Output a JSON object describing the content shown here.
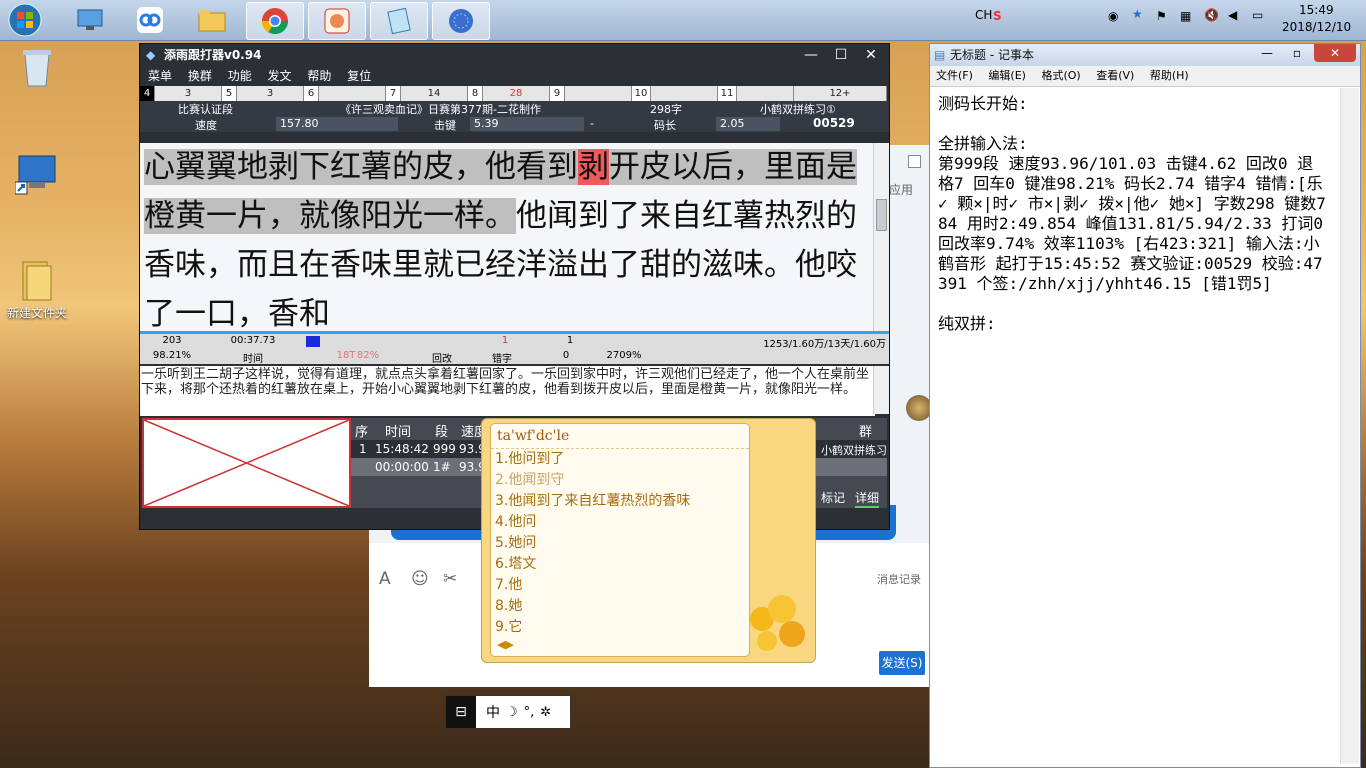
{
  "taskbar": {
    "apps": [
      {
        "icon": "start-orb-icon"
      },
      {
        "icon": "remote-desktop-icon"
      },
      {
        "icon": "baidu-netdisk-icon"
      },
      {
        "icon": "file-explorer-icon"
      },
      {
        "icon": "chrome-icon"
      },
      {
        "icon": "app-typing-icon"
      },
      {
        "icon": "notepad-icon"
      },
      {
        "icon": "blue-sphere-icon"
      }
    ],
    "tray": {
      "ime": "CH",
      "time": "15:49",
      "date": "2018/12/10"
    }
  },
  "desktop": {
    "icons": [
      {
        "label": "",
        "icon": "recycle-bin-icon"
      },
      {
        "label": "",
        "icon": "computer-shortcut-icon"
      },
      {
        "label": "新建文件夹",
        "icon": "folder-icon"
      }
    ]
  },
  "typer": {
    "title": "添雨跟打器v0.94",
    "menu": [
      "菜单",
      "换群",
      "功能",
      "发文",
      "帮助",
      "复位"
    ],
    "cells": [
      "4",
      "3",
      "5",
      "3",
      "6",
      "",
      "7",
      "14",
      "8",
      "28",
      "9",
      "",
      "10",
      "",
      "11",
      "",
      "12+"
    ],
    "info": {
      "mode": "比赛认证段",
      "article": "《许三观卖血记》日赛第377期-二花制作",
      "chars": "298字",
      "course": "小鹤双拼练习①"
    },
    "readout": {
      "speed_label": "速度",
      "speed": "157.80",
      "keystroke_label": "击键",
      "keystroke": "5.39",
      "dash": "-",
      "codelen_label": "码长",
      "codelen": "2.05",
      "code": "00529"
    },
    "text_typed": "心翼翼地剥下红薯的皮，他看到",
    "text_wrong": "剥",
    "text_typed2": "开皮以后，里面是橙黄一片，就像阳光一样。",
    "text_rest": "他闻到了来自红薯热烈的香味，而且在香味里就已经洋溢出了甜的滋味。他咬了一口，香和",
    "stats_row1": {
      "a": "203",
      "b": "00:37.73",
      "c": "1",
      "d": "1",
      "e": "1253/1.60万/13天/1.60万"
    },
    "stats_row2": {
      "a": "98.21%",
      "b": "时间",
      "c": "18T",
      "c2": "82%",
      "d": "回改",
      "e": "错字",
      "f": "0",
      "g": "2709%"
    },
    "ref_text": "一乐听到王二胡子这样说，觉得有道理，就点点头拿着红薯回家了。一乐回到家中时，许三观他们已经走了，他一个人在桌前坐下来，将那个还热着的红薯放在桌上，开始小心翼翼地剥下红薯的皮，他看到拨开皮以后，里面是橙黄一片，就像阳光一样。",
    "table": {
      "headers": [
        "序",
        "时间",
        "段",
        "速度"
      ],
      "group_header": "群",
      "rows": [
        {
          "n": "1",
          "time": "15:48:42",
          "seg": "999",
          "speed": "93.9",
          "extra": "小鹤双拼练习"
        },
        {
          "n": "",
          "time": "00:00:00",
          "seg": "1#",
          "speed": "93.9",
          "extra": ""
        }
      ],
      "buttons": [
        "标记",
        "详细"
      ]
    }
  },
  "chat": {
    "checkbox_label": "应用",
    "msg_record": "消息记录",
    "send": "发送(S)"
  },
  "ime": {
    "composition": "ta'wf'dc'le",
    "candidates": [
      "1.他问到了",
      "2.他闻到守",
      "3.他闻到了来自红薯热烈的香味",
      "4.他问",
      "5.她问",
      "6.塔文",
      "7.他",
      "8.她",
      "9.它"
    ],
    "status_glyph": "中"
  },
  "ime_toolbar": {
    "lang": "中",
    "items": [
      "中",
      "☽",
      "°,",
      "✲"
    ]
  },
  "notepad": {
    "title": "无标题 - 记事本",
    "menu": [
      "文件(F)",
      "编辑(E)",
      "格式(O)",
      "查看(V)",
      "帮助(H)"
    ],
    "content": "测码长开始:\n\n全拼输入法:\n第999段 速度93.96/101.03 击键4.62 回改0 退格7 回车0 键准98.21% 码长2.74 错字4 错情:[乐✓ 颗×|时✓ 市×|剥✓ 拨×|他✓ 她×] 字数298 键数784 用时2:49.854 峰值131.81/5.94/2.33 打词0 回改率9.74% 效率1103% [右423:321] 输入法:小鹤音形 起打于15:45:52 赛文验证:00529 校验:47391 个签:/zhh/xjj/yhht46.15 [错1罚5]\n\n纯双拼:"
  },
  "colors": {
    "typer_bg": "#2b2f36",
    "wrong_bg": "#ee5a5a",
    "ime_bg": "#f8d780",
    "accent": "#1a73d0"
  }
}
